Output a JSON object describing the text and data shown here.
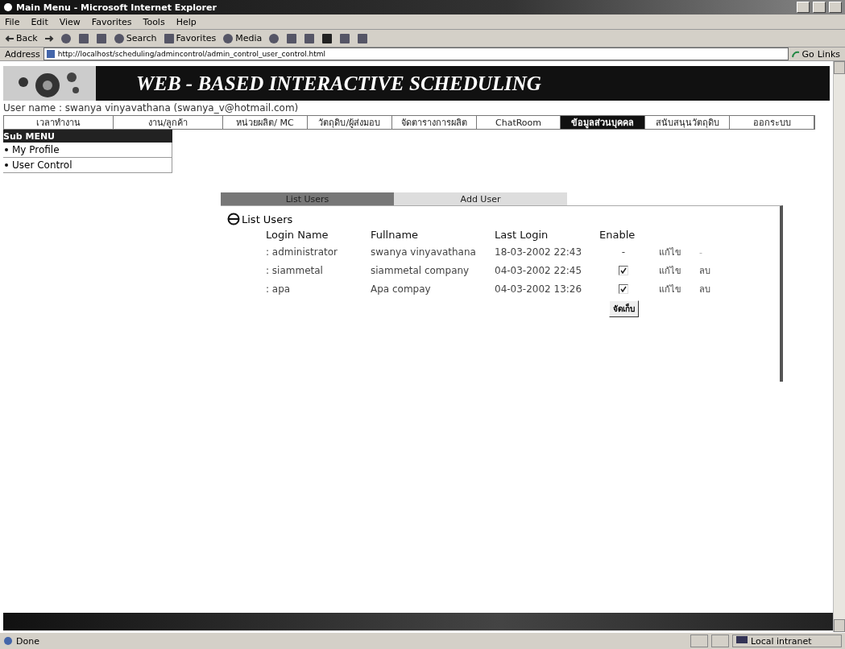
{
  "window": {
    "title": "Main Menu - Microsoft Internet Explorer"
  },
  "menu_bar": [
    "File",
    "Edit",
    "View",
    "Favorites",
    "Tools",
    "Help"
  ],
  "toolbar": [
    {
      "kind": "back",
      "label": "Back"
    },
    {
      "kind": "forward"
    },
    {
      "kind": "stop"
    },
    {
      "kind": "refresh"
    },
    {
      "kind": "home"
    },
    {
      "kind": "search",
      "label": "Search"
    },
    {
      "kind": "favorites",
      "label": "Favorites"
    },
    {
      "kind": "media",
      "label": "Media"
    },
    {
      "kind": "history"
    },
    {
      "kind": "mail"
    },
    {
      "kind": "print"
    },
    {
      "kind": "edit"
    },
    {
      "kind": "discuss"
    },
    {
      "kind": "messenger"
    }
  ],
  "address_bar": {
    "label": "Address",
    "url": "http://localhost/scheduling/admincontrol/admin_control_user_control.html",
    "go": "Go",
    "links": "Links"
  },
  "banner": {
    "title": "WEB - BASED INTERACTIVE SCHEDULING"
  },
  "user_line": "User name : swanya vinyavathana (swanya_v@hotmail.com)",
  "nav": [
    {
      "label": "เวลาทำงาน",
      "selected": false
    },
    {
      "label": "งาน/ลูกค้า",
      "selected": false
    },
    {
      "label": "หน่วยผลิต/ MC",
      "selected": false
    },
    {
      "label": "วัตถุดิบ/ผู้ส่งมอบ",
      "selected": false
    },
    {
      "label": "จัดตารางการผลิต",
      "selected": false
    },
    {
      "label": "ChatRoom",
      "selected": false
    },
    {
      "label": "ข้อมูลส่วนบุคคล",
      "selected": true
    },
    {
      "label": "สนับสนุนวัตถุดิบ",
      "selected": false
    },
    {
      "label": "ออกระบบ",
      "selected": false
    }
  ],
  "sub_menu": {
    "title": "Sub MENU",
    "items": [
      "My Profile",
      "User Control"
    ]
  },
  "tabs": [
    {
      "label": "List Users",
      "selected": true
    },
    {
      "label": "Add User",
      "selected": false
    }
  ],
  "list": {
    "title": "List Users",
    "columns": [
      "Login Name",
      "Fullname",
      "Last Login",
      "Enable"
    ],
    "rows": [
      {
        "login": ": administrator",
        "fullname": "swanya vinyavathana",
        "last_login": "18-03-2002 22:43",
        "enable": {
          "kind": "text",
          "text": "-"
        },
        "edit": "แก้ไข",
        "delete": {
          "kind": "text",
          "text": "-"
        }
      },
      {
        "login": ": siammetal",
        "fullname": "siammetal company",
        "last_login": "04-03-2002 22:45",
        "enable": {
          "kind": "checkbox",
          "checked": true
        },
        "edit": "แก้ไข",
        "delete": {
          "kind": "link",
          "text": "ลบ"
        }
      },
      {
        "login": ": apa",
        "fullname": "Apa compay",
        "last_login": "04-03-2002 13:26",
        "enable": {
          "kind": "checkbox",
          "checked": true
        },
        "edit": "แก้ไข",
        "delete": {
          "kind": "link",
          "text": "ลบ"
        }
      }
    ],
    "save": "จัดเก็บ"
  },
  "status_bar": {
    "text": "Done",
    "zone": "Local intranet"
  }
}
